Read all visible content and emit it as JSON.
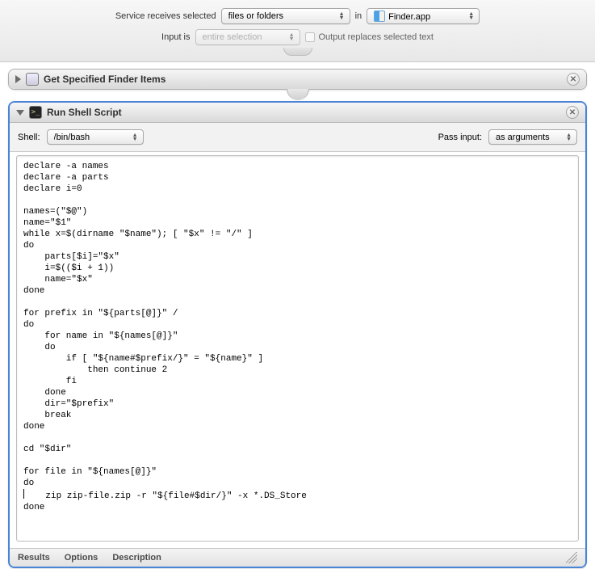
{
  "topbar": {
    "service_label": "Service receives selected",
    "inputType": "files or folders",
    "in_label": "in",
    "app": "Finder.app",
    "input_is_label": "Input is",
    "inputScope": "entire selection",
    "replaces_label": "Output replaces selected text"
  },
  "action1": {
    "title": "Get Specified Finder Items"
  },
  "action2": {
    "title": "Run Shell Script",
    "shell_label": "Shell:",
    "shell": "/bin/bash",
    "passinput_label": "Pass input:",
    "passinput": "as arguments",
    "script": "declare -a names\ndeclare -a parts\ndeclare i=0\n\nnames=(\"$@\")\nname=\"$1\"\nwhile x=$(dirname \"$name\"); [ \"$x\" != \"/\" ]\ndo\n    parts[$i]=\"$x\"\n    i=$(($i + 1))\n    name=\"$x\"\ndone\n\nfor prefix in \"${parts[@]}\" /\ndo\n    for name in \"${names[@]}\"\n    do\n        if [ \"${name#$prefix/}\" = \"${name}\" ]\n            then continue 2\n        fi\n    done\n    dir=\"$prefix\"\n    break\ndone\n\ncd \"$dir\"\n\nfor file in \"${names[@]}\"\ndo\n    zip zip-file.zip -r \"${file#$dir/}\" -x *.DS_Store\ndone\n"
  },
  "footer": {
    "results": "Results",
    "options": "Options",
    "description": "Description"
  }
}
